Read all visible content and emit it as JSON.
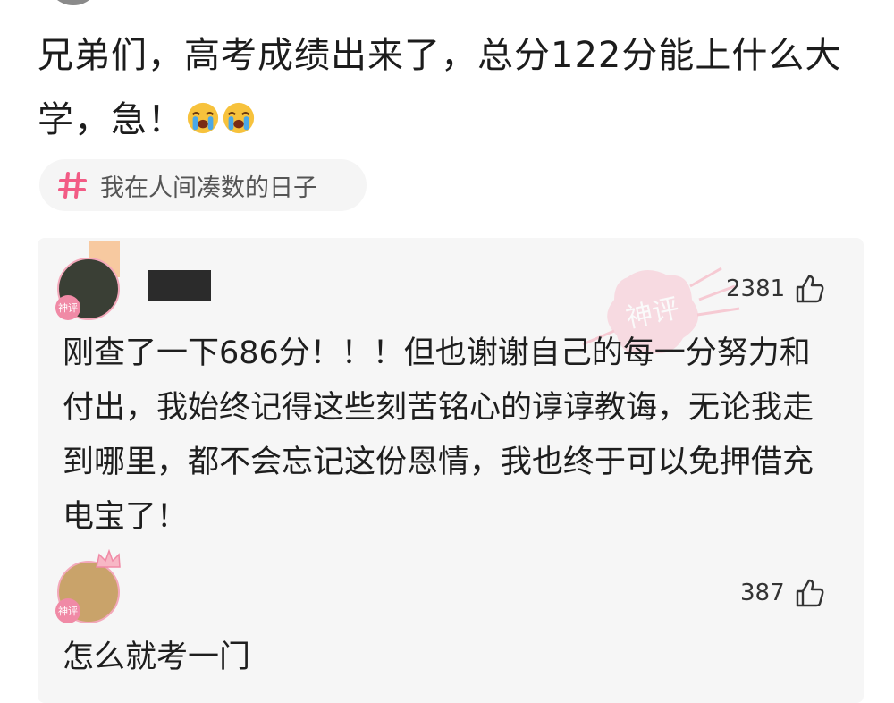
{
  "post": {
    "text": "兄弟们，高考成绩出来了，总分122分能上什么大学，急！",
    "emoji": [
      "crying-face",
      "crying-face"
    ]
  },
  "topic": {
    "label": "我在人间凑数的日子",
    "hash_color": "#f25b85"
  },
  "stamp_text": "神评",
  "comments": [
    {
      "likes": "2381",
      "text": "刚查了一下686分！！！但也谢谢自己的每一分努力和付出，我始终记得这些刻苦铭心的谆谆教诲，无论我走到哪里，都不会忘记这份恩情，我也终于可以免押借充电宝了！",
      "badge": "神评"
    },
    {
      "likes": "387",
      "text": "怎么就考一门",
      "badge": "神评"
    }
  ],
  "colors": {
    "panel_bg": "#f6f6f6",
    "accent_pink": "#f25b85",
    "text": "#1e1e1e"
  }
}
